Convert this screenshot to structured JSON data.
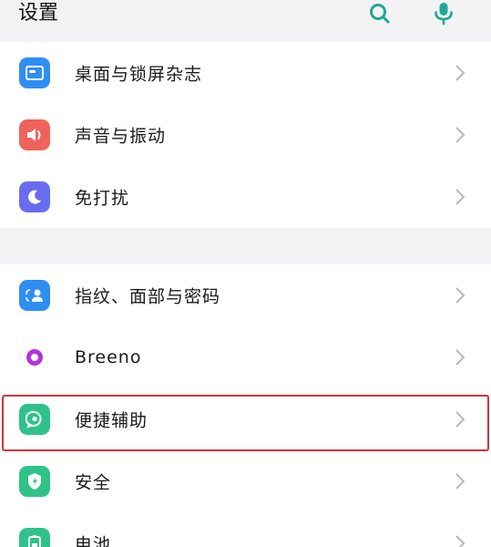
{
  "header": {
    "title": "设置",
    "search_icon": "search-icon",
    "mic_icon": "microphone-icon",
    "accent_color": "#1fa88f"
  },
  "groups": [
    {
      "items": [
        {
          "label": "桌面与锁屏杂志",
          "icon": "wallpaper-icon",
          "color": "#2f8ef4"
        },
        {
          "label": "声音与振动",
          "icon": "speaker-icon",
          "color": "#f0625c"
        },
        {
          "label": "免打扰",
          "icon": "moon-icon",
          "color": "#6a6cf0"
        }
      ]
    },
    {
      "items": [
        {
          "label": "指纹、面部与密码",
          "icon": "fingerprint-face-icon",
          "color": "#2f8ef4"
        },
        {
          "label": "Breeno",
          "icon": "breeno-icon",
          "color": "#b435d9"
        },
        {
          "label": "便捷辅助",
          "icon": "assist-icon",
          "color": "#2fc38a",
          "highlighted": true
        },
        {
          "label": "安全",
          "icon": "security-shield-icon",
          "color": "#2fc38a"
        },
        {
          "label": "电池",
          "icon": "battery-icon",
          "color": "#2fc38a"
        }
      ]
    }
  ],
  "highlight_color": "#d9313a"
}
